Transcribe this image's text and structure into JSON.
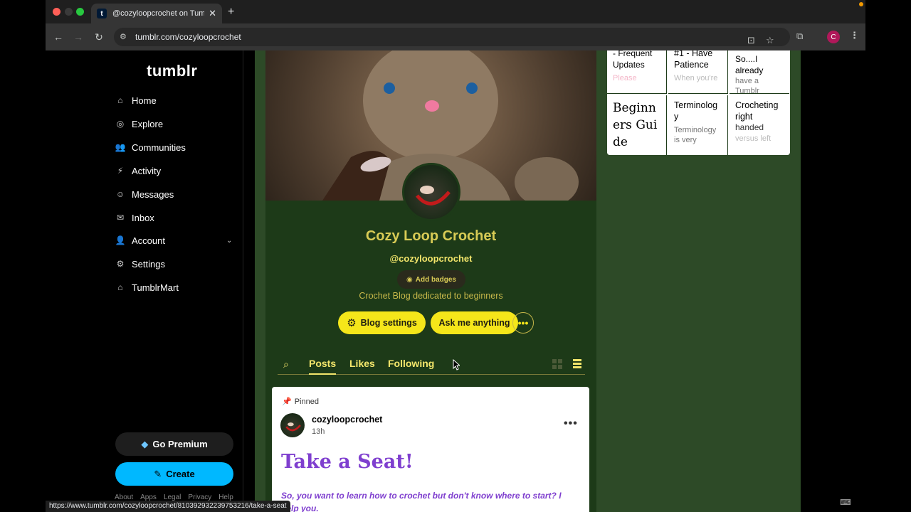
{
  "browser": {
    "tab_title": "@cozyloopcrochet on Tumblr",
    "url": "tumblr.com/cozyloopcrochet",
    "profile_initial": "C",
    "status_url": "https://www.tumblr.com/cozyloopcrochet/810392932239753216/take-a-seat"
  },
  "sidebar": {
    "logo": "tumblr",
    "items": [
      {
        "label": "Home",
        "icon": "home-icon"
      },
      {
        "label": "Explore",
        "icon": "compass-icon"
      },
      {
        "label": "Communities",
        "icon": "people-icon"
      },
      {
        "label": "Activity",
        "icon": "lightning-icon"
      },
      {
        "label": "Messages",
        "icon": "smiley-chat-icon"
      },
      {
        "label": "Inbox",
        "icon": "envelope-icon"
      },
      {
        "label": "Account",
        "icon": "person-icon"
      },
      {
        "label": "Settings",
        "icon": "gear-icon"
      },
      {
        "label": "TumblrMart",
        "icon": "store-icon"
      }
    ],
    "premium_label": "Go Premium",
    "create_label": "Create",
    "footer": [
      "About",
      "Apps",
      "Legal",
      "Privacy",
      "Help"
    ]
  },
  "blog": {
    "title": "Cozy Loop Crochet",
    "handle": "@cozyloopcrochet",
    "badges_label": "Add badges",
    "description": "Crochet Blog dedicated to beginners",
    "settings_label": "Blog settings",
    "ask_label": "Ask me anything",
    "tabs": [
      "Posts",
      "Likes",
      "Following"
    ]
  },
  "post": {
    "pinned_label": "Pinned",
    "username": "cozyloopcrochet",
    "time": "13h",
    "heading": "Take a Seat!",
    "body_line1": "So, you want to learn how to crochet but don't know where to start? I",
    "body_line2": "help you."
  },
  "related": [
    {
      "title": "- Frequent Updates",
      "sub": "",
      "extra": "Please",
      "extra_style": "pink"
    },
    {
      "title": "#1 - Have Patience",
      "sub": "",
      "extra": "When you're",
      "extra_style": "fade"
    },
    {
      "title": "So....I already",
      "sub": "have a Tumblr",
      "extra": "",
      "extra_style": ""
    },
    {
      "title": "Beginners Guide",
      "sub": "",
      "extra": "...",
      "extra_style": "fade"
    },
    {
      "title": "Terminology",
      "sub": "Terminology is very",
      "extra": "",
      "extra_style": ""
    },
    {
      "title": "Crocheting right",
      "sub": "handed",
      "extra": "versus left",
      "extra_style": "fade"
    }
  ],
  "colors": {
    "blog_bg": "#1d3a18",
    "page_bg": "#2d4a27",
    "accent_yellow": "#f5e61a",
    "title_gold": "#d8cb55",
    "create_blue": "#00b8ff",
    "post_purple": "#7f3fcf"
  }
}
